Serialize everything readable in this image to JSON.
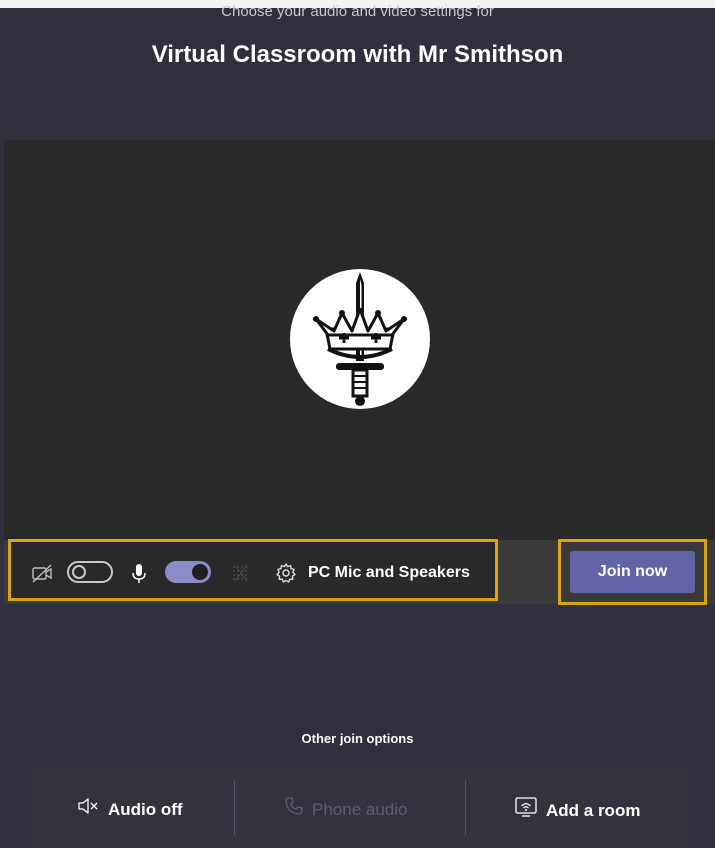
{
  "header": {
    "subtitle": "Choose your audio and video settings for",
    "meeting_title": "Virtual Classroom with Mr Smithson"
  },
  "preview": {
    "avatar_icon": "crowned-sword-crest"
  },
  "controls": {
    "camera_icon": "camera-off-icon",
    "camera_toggle_state": "off",
    "mic_icon": "microphone-icon",
    "mic_toggle_state": "on",
    "noise_icon": "background-blur-icon",
    "settings_icon": "gear-icon",
    "device_label": "PC Mic and Speakers",
    "join_label": "Join now"
  },
  "other_options": {
    "heading": "Other join options",
    "items": [
      {
        "label": "Audio off",
        "icon": "speaker-muted-icon",
        "enabled": true
      },
      {
        "label": "Phone audio",
        "icon": "phone-icon",
        "enabled": false
      },
      {
        "label": "Add a room",
        "icon": "room-cast-icon",
        "enabled": true
      }
    ]
  },
  "colors": {
    "background": "#2f2f3d",
    "preview": "#292929",
    "highlight": "#d9a40f",
    "accent": "#6264a7",
    "toggle_on": "#8b8cc7"
  }
}
